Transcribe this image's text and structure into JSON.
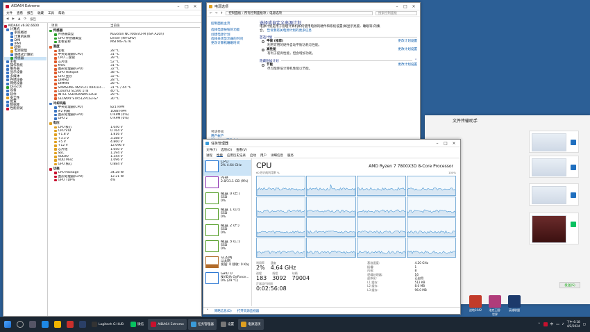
{
  "aida": {
    "title": "AIDA64 Extreme",
    "menu": [
      "文件",
      "查看",
      "报告",
      "收藏",
      "工具",
      "帮助"
    ],
    "toolbar": [
      "报告"
    ],
    "tree": [
      {
        "label": "AIDA64 v6.92.6600",
        "c": "#c8102e"
      },
      {
        "label": "计算机",
        "c": "#3a75c4"
      },
      {
        "label": "系统概述",
        "c": "#3a75c4"
      },
      {
        "label": "计算机名称",
        "c": "#3a75c4"
      },
      {
        "label": "DMI",
        "c": "#3a75c4"
      },
      {
        "label": "IPMI",
        "c": "#3a75c4"
      },
      {
        "label": "超频",
        "c": "#e0a020"
      },
      {
        "label": "电源管理",
        "c": "#e0a020"
      },
      {
        "label": "便携式计算机",
        "c": "#3a75c4"
      },
      {
        "label": "传感器",
        "c": "#2ca02c"
      },
      {
        "label": "主板",
        "c": "#3a75c4"
      },
      {
        "label": "操作系统",
        "c": "#3a75c4"
      },
      {
        "label": "服务器",
        "c": "#3a75c4"
      },
      {
        "label": "显示设备",
        "c": "#3a75c4"
      },
      {
        "label": "多媒体",
        "c": "#3a75c4"
      },
      {
        "label": "存储设备",
        "c": "#3a75c4"
      },
      {
        "label": "网络设备",
        "c": "#3a75c4"
      },
      {
        "label": "DirectX",
        "c": "#2ca02c"
      },
      {
        "label": "设备",
        "c": "#3a75c4"
      },
      {
        "label": "软件",
        "c": "#3a75c4"
      },
      {
        "label": "安全性",
        "c": "#e0a020"
      },
      {
        "label": "配置",
        "c": "#3a75c4"
      },
      {
        "label": "数据库",
        "c": "#3a75c4"
      },
      {
        "label": "性能测试",
        "c": "#c8102e"
      }
    ],
    "col_item": "项目",
    "col_value": "当前值",
    "sections": [
      {
        "title": "传感器",
        "rows": [
          [
            "传感器类型",
            "Nuvoton NCT6687D-M (ISA A20h)"
          ],
          [
            "GPU 传感器类型",
            "Driver (NV-DRV)"
          ],
          [
            "主板名称",
            "MSI MS-7E76"
          ]
        ]
      },
      {
        "title": "温度",
        "rows": [
          [
            "主板",
            "28 °C"
          ],
          [
            "中央处理器(CPU)",
            "31 °C"
          ],
          [
            "CPU 二极管",
            "39 °C"
          ],
          [
            "芯片组",
            "52 °C"
          ],
          [
            "MOS",
            "31 °C"
          ],
          [
            "图形处理器(GPU)",
            "32 °C"
          ],
          [
            "GPU Hotspot",
            "38 °C"
          ],
          [
            "GPU 显存",
            "32 °C"
          ],
          [
            "DIMM2",
            "28 °C"
          ],
          [
            "DIMM4",
            "28 °C"
          ],
          [
            "SAMSUNG MZVL21T0HCLR-...",
            "31 °C / 44 °C"
          ],
          [
            "Colorful SL500 1TB",
            "40 °C"
          ],
          [
            "INTEL SSDPEKNW512G8",
            "29 °C"
          ],
          [
            "GLOWAY STK512PCS3-S7",
            "30 °C"
          ]
        ]
      },
      {
        "title": "冷却风扇",
        "rows": [
          [
            "中央处理器(CPU)",
            "821 RPM"
          ],
          [
            "#2 机箱",
            "1088 RPM"
          ],
          [
            "图形处理器(GPU)",
            "0 RPM  (0%)"
          ],
          [
            "GPU 2",
            "0 RPM  (0%)"
          ]
        ]
      },
      {
        "title": "电压",
        "rows": [
          [
            "CPU 核心",
            "1.040 V"
          ],
          [
            "CPU VID",
            "0.764 V"
          ],
          [
            "+1.8 V",
            "1.816 V"
          ],
          [
            "+3.3 V",
            "3.288 V"
          ],
          [
            "+5 V",
            "4.860 V"
          ],
          [
            "+12 V",
            "12.096 V"
          ],
          [
            "芯片组",
            "1.050 V"
          ],
          [
            "SoC",
            "1.294 V"
          ],
          [
            "VDDIO",
            "1.344 V"
          ],
          [
            "VDD Misc",
            "1.096 V"
          ],
          [
            "GPU 核心",
            "0.884 V"
          ]
        ]
      },
      {
        "title": "功耗",
        "rows": [
          [
            "CPU Package",
            "34.28 W"
          ],
          [
            "图形处理器(GPU)",
            "12.21 W"
          ],
          [
            "GPU TDP%",
            "4%"
          ]
        ]
      }
    ]
  },
  "power": {
    "title": "电源选项",
    "breadcrumb": "控制面板 › 所有控制面板项 › 电源选项",
    "search_placeholder": "搜索控制面板",
    "left_top": "控制面板主页",
    "left_links": [
      "选择电源按钮的功能",
      "创建电源计划",
      "选择关闭显示器的时间",
      "更改计算机睡眠时间"
    ],
    "heading": "选择或自定义电源计划",
    "desc": "电源计划是用于管理计算机如何使用电源的硬件和系统设置(如显示亮度、睡眠等)的集合。",
    "desc_link": "告诉我有关电源计划的更多信息",
    "group1": "首选计划",
    "plans1": [
      {
        "name": "平衡 (推荐)",
        "sub": "利用可用的硬件自动平衡功耗与性能。",
        "link": "更改计划设置",
        "on": false
      },
      {
        "name": "高性能",
        "sub": "有利于提高性能，但会增加功耗。",
        "link": "更改计划设置",
        "on": true
      }
    ],
    "group2": "隐藏附加计划",
    "plans2": [
      {
        "name": "节能",
        "sub": "尽可能降低计算机性能以节能。",
        "link": "更改计划设置",
        "on": false
      }
    ],
    "see_also": [
      "另请参阅",
      "用户帐户",
      "Windows 移动中心"
    ]
  },
  "ft": {
    "title": "文件传输助手",
    "send": "发送(S)"
  },
  "tm": {
    "title": "任务管理器",
    "menu": [
      "文件(F)",
      "选项(O)",
      "查看(V)"
    ],
    "tabs": [
      "进程",
      "性能",
      "应用历史记录",
      "启动",
      "用户",
      "详细信息",
      "服务"
    ],
    "resources": [
      {
        "name": "CPU",
        "sub": "2% 4.64 GHz",
        "c": "#1e6fd0"
      },
      {
        "name": "内存",
        "sub": "2.8/31.1 GB (9%)",
        "c": "#8b2fb0"
      },
      {
        "name": "磁盘 0 (E:)",
        "sub": "SSD",
        "sub2": "0%",
        "c": "#4d9a1f"
      },
      {
        "name": "磁盘 1 (D:)",
        "sub": "SSD",
        "sub2": "0%",
        "c": "#4d9a1f"
      },
      {
        "name": "磁盘 2 (F:)",
        "sub": "SSD",
        "sub2": "0%",
        "c": "#4d9a1f"
      },
      {
        "name": "磁盘 3 (C:)",
        "sub": "SSD",
        "sub2": "0%",
        "c": "#4d9a1f"
      },
      {
        "name": "以太网",
        "sub": "以太网",
        "sub2": "发送: 0 接收: 0 Kbps",
        "c": "#b26c2b"
      },
      {
        "name": "GPU 0",
        "sub": "NVIDIA GeForce...",
        "sub2": "0% (29 °C)",
        "c": "#1e6fd0"
      }
    ],
    "cpu_title": "CPU",
    "cpu_model": "AMD Ryzen 7 7800X3D 8-Core Processor",
    "graph_label_left": "60 秒内的利用率 %",
    "graph_label_right": "100%",
    "stats_left": [
      [
        {
          "l": "利用率",
          "v": "2%"
        },
        {
          "l": "速度",
          "v": "4.64 GHz"
        }
      ],
      [
        {
          "l": "进程",
          "v": "183"
        },
        {
          "l": "线程",
          "v": "3092"
        },
        {
          "l": "句柄",
          "v": "79004"
        }
      ],
      [
        {
          "l": "正常运行时间",
          "v": "0:02:56:08"
        }
      ]
    ],
    "stats_right": [
      [
        "基准速度:",
        "4.20 GHz"
      ],
      [
        "插槽:",
        "1"
      ],
      [
        "内核:",
        "8"
      ],
      [
        "逻辑处理器:",
        "16"
      ],
      [
        "虚拟化:",
        "已启用"
      ],
      [
        "L1 缓存:",
        "512 KB"
      ],
      [
        "L2 缓存:",
        "8.0 MB"
      ],
      [
        "L3 缓存:",
        "96.0 MB"
      ]
    ],
    "footer_less": "简略信息(D)",
    "footer_monitor": "打开资源监视器"
  },
  "desktop": [
    {
      "label": "战地2042",
      "c": "#c23b2a"
    },
    {
      "label": "洛克王国: 世界",
      "c": "#b03c7a"
    },
    {
      "label": "英雄联盟",
      "c": "#1c3a6b"
    }
  ],
  "taskbar": {
    "search": "",
    "apps": [
      {
        "label": "Logitech G HUB",
        "c": "#333",
        "on": false
      },
      {
        "label": "微信",
        "c": "#07c160",
        "on": false
      },
      {
        "label": "AIDA64 Extreme",
        "c": "#c8102e",
        "on": true
      },
      {
        "label": "任务管理器",
        "c": "#3a9bd9",
        "on": true
      },
      {
        "label": "设置",
        "c": "#777",
        "on": false
      },
      {
        "label": "电源选项",
        "c": "#e0a020",
        "on": true
      }
    ],
    "time": "下午 6:18",
    "date": "4/2/2024",
    "lang": "中"
  }
}
